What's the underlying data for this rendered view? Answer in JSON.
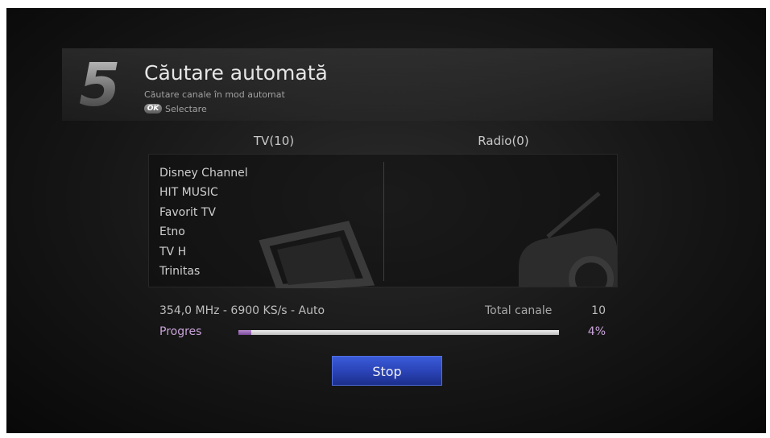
{
  "header": {
    "step_number": "5",
    "title": "Căutare automată",
    "subtitle": "Căutare canale în mod automat",
    "ok_badge": "OK",
    "ok_action": "Selectare"
  },
  "columns": {
    "tv_title": "TV(10)",
    "radio_title": "Radio(0)"
  },
  "tv_channels": [
    "Disney Channel",
    "HIT MUSIC",
    "Favorit TV",
    "Etno",
    "TV H",
    "Trinitas"
  ],
  "radio_channels": [],
  "status": {
    "frequency_info": "354,0 MHz - 6900 KS/s - Auto",
    "total_label": "Total canale",
    "total_value": "10",
    "progress_label": "Progres",
    "progress_percent_text": "4%",
    "progress_fraction": 0.04
  },
  "actions": {
    "stop_label": "Stop"
  },
  "colors": {
    "accent_progress": "#9b6bbf",
    "button_blue": "#2b44b8"
  },
  "icons": {
    "tv_watermark": "tv-watermark-icon",
    "radio_watermark": "radio-watermark-icon"
  }
}
